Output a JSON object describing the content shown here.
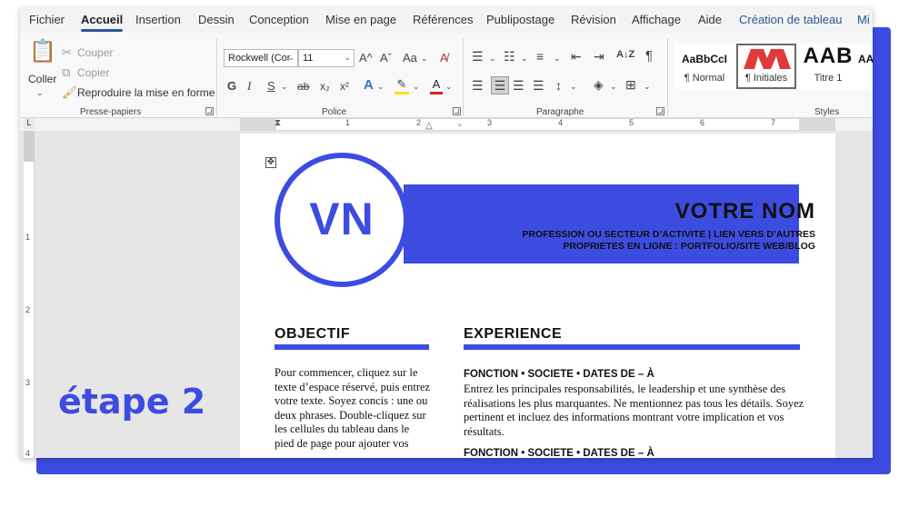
{
  "tabs": [
    "Fichier",
    "Accueil",
    "Insertion",
    "Dessin",
    "Conception",
    "Mise en page",
    "Références",
    "Publipostage",
    "Révision",
    "Affichage",
    "Aide",
    "Création de tableau",
    "Mi"
  ],
  "active_tab": "Accueil",
  "clipboard": {
    "paste_label": "Coller",
    "cut_label": "Couper",
    "copy_label": "Copier",
    "format_painter_label": "Reproduire la mise en forme",
    "group_label": "Presse-papiers"
  },
  "font": {
    "font_name": "Rockwell (Cor",
    "font_size": "11",
    "group_label": "Police",
    "bold": "G",
    "italic": "I",
    "underline": "S",
    "strike": "ab",
    "subscript": "x₂",
    "superscript": "x²",
    "grow": "A^",
    "shrink": "Aˇ",
    "case": "Aa",
    "text_effects": "A",
    "font_color": "A"
  },
  "paragraph": {
    "group_label": "Paragraphe",
    "sort": "A↓Z",
    "pilcrow": "¶"
  },
  "styles": {
    "group_label": "Styles",
    "items": [
      {
        "sample": "AaBbCcI",
        "name": "¶ Normal"
      },
      {
        "sample": "",
        "name": "¶ Initiales"
      },
      {
        "sample": "AAB",
        "name": "Titre 1"
      },
      {
        "sample": "AA",
        "name": ""
      }
    ]
  },
  "ruler": {
    "h_numbers": [
      "1",
      "2",
      "3",
      "4",
      "5",
      "6",
      "7"
    ],
    "v_numbers": [
      "1",
      "2",
      "3",
      "4"
    ],
    "corner": "L"
  },
  "resume": {
    "initials": "VN",
    "name": "VOTRE NOM",
    "profession": "PROFESSION OU SECTEUR D’ACTIVITE | LIEN VERS D’AUTRES PROPRIETES EN LIGNE : PORTFOLIO/SITE WEB/BLOG",
    "objective_title": "OBJECTIF",
    "objective_text": "Pour commencer, cliquez sur le texte d’espace réservé, puis entrez votre texte. Soyez concis : une ou deux phrases. Double-cliquez sur les cellules du tableau dans le pied de page pour ajouter vos",
    "experience_title": "EXPERIENCE",
    "job1_head": "FONCTION • SOCIETE • DATES DE – À",
    "job1_text": "Entrez les principales responsabilités, le leadership et une synthèse des réalisations les plus marquantes. Ne mentionnez pas tous les détails. Soyez pertinent et incluez des informations montrant votre implication et vos résultats.",
    "job2_head": "FONCTION • SOCIETE • DATES DE – À"
  },
  "overlay": {
    "step_label": "étape 2"
  },
  "colors": {
    "accent": "#3d4ce0",
    "initiales_style": "#e03a3a",
    "font_color_bar": "#e02020",
    "highlight_bar": "#f5e400"
  }
}
